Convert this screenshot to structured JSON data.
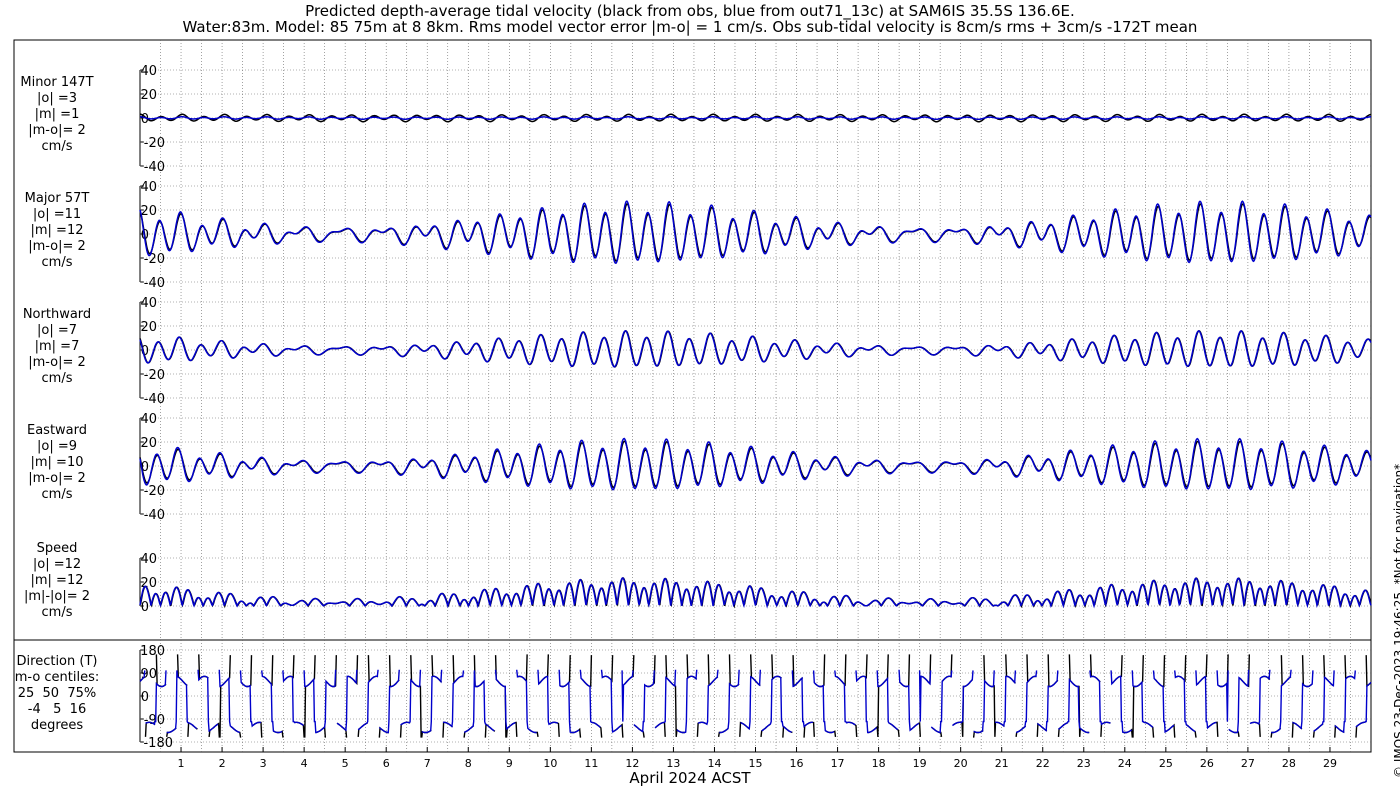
{
  "title_line1": "Predicted depth-average tidal velocity (black from obs, blue from out71_13c) at SAM6IS 35.5S 136.6E.",
  "title_line2": "Water:83m. Model: 85 75m at 8 8km. Rms model vector error |m-o| = 1 cm/s. Obs sub-tidal velocity is 8cm/s rms + 3cm/s -172T mean",
  "xlabel": "April 2024 ACST",
  "copyright": "© IMOS 23-Dec-2023 19:46:25. *Not for navigation*",
  "colors": {
    "obs": "#000000",
    "model": "#0000cc",
    "grid": "#666666"
  },
  "chart_data": [
    {
      "type": "line",
      "panel": "minor",
      "label_lines": [
        "Minor 147T",
        "|o| =3",
        "|m| =1",
        "|m-o|= 2",
        "cm/s"
      ],
      "ylim": [
        -40,
        40
      ],
      "yticks": [
        -40,
        -20,
        0,
        20,
        40
      ],
      "obs_amp": 3,
      "model_amp": 1,
      "series": [
        {
          "name": "obs"
        },
        {
          "name": "model"
        }
      ]
    },
    {
      "type": "line",
      "panel": "major",
      "label_lines": [
        "Major 57T",
        "|o| =11",
        "|m| =12",
        "|m-o|= 2",
        "cm/s"
      ],
      "ylim": [
        -40,
        40
      ],
      "yticks": [
        -40,
        -20,
        0,
        20,
        40
      ],
      "obs_amp": 11,
      "model_amp": 12,
      "series": [
        {
          "name": "obs"
        },
        {
          "name": "model"
        }
      ]
    },
    {
      "type": "line",
      "panel": "north",
      "label_lines": [
        "Northward",
        "|o| =7",
        "|m| =7",
        "|m-o|= 2",
        "cm/s"
      ],
      "ylim": [
        -40,
        40
      ],
      "yticks": [
        -40,
        -20,
        0,
        20,
        40
      ],
      "obs_amp": 7,
      "model_amp": 7,
      "series": [
        {
          "name": "obs"
        },
        {
          "name": "model"
        }
      ]
    },
    {
      "type": "line",
      "panel": "east",
      "label_lines": [
        "Eastward",
        "|o| =9",
        "|m| =10",
        "|m-o|= 2",
        "cm/s"
      ],
      "ylim": [
        -40,
        40
      ],
      "yticks": [
        -40,
        -20,
        0,
        20,
        40
      ],
      "obs_amp": 9,
      "model_amp": 10,
      "series": [
        {
          "name": "obs"
        },
        {
          "name": "model"
        }
      ]
    },
    {
      "type": "line",
      "panel": "speed",
      "label_lines": [
        "Speed",
        "|o| =12",
        "|m| =12",
        "|m|-|o|= 2",
        "cm/s"
      ],
      "ylim": [
        0,
        40
      ],
      "yticks": [
        0,
        20,
        40
      ],
      "obs_amp": 12,
      "model_amp": 12,
      "series": [
        {
          "name": "obs"
        },
        {
          "name": "model"
        }
      ]
    },
    {
      "type": "line",
      "panel": "direction",
      "label_lines": [
        "Direction (T)",
        "m-o centiles:",
        "25  50  75%",
        "-4   5  16",
        "degrees"
      ],
      "ylim": [
        -180,
        180
      ],
      "yticks": [
        -180,
        -90,
        0,
        90,
        180
      ],
      "series": [
        {
          "name": "obs"
        },
        {
          "name": "model"
        }
      ]
    }
  ],
  "x_axis": {
    "day_start": 0,
    "day_end": 30,
    "tick_labels": [
      "1",
      "2",
      "3",
      "4",
      "5",
      "6",
      "7",
      "8",
      "9",
      "10",
      "11",
      "12",
      "13",
      "14",
      "15",
      "16",
      "17",
      "18",
      "19",
      "20",
      "21",
      "22",
      "23",
      "24",
      "25",
      "26",
      "27",
      "28",
      "29"
    ]
  }
}
